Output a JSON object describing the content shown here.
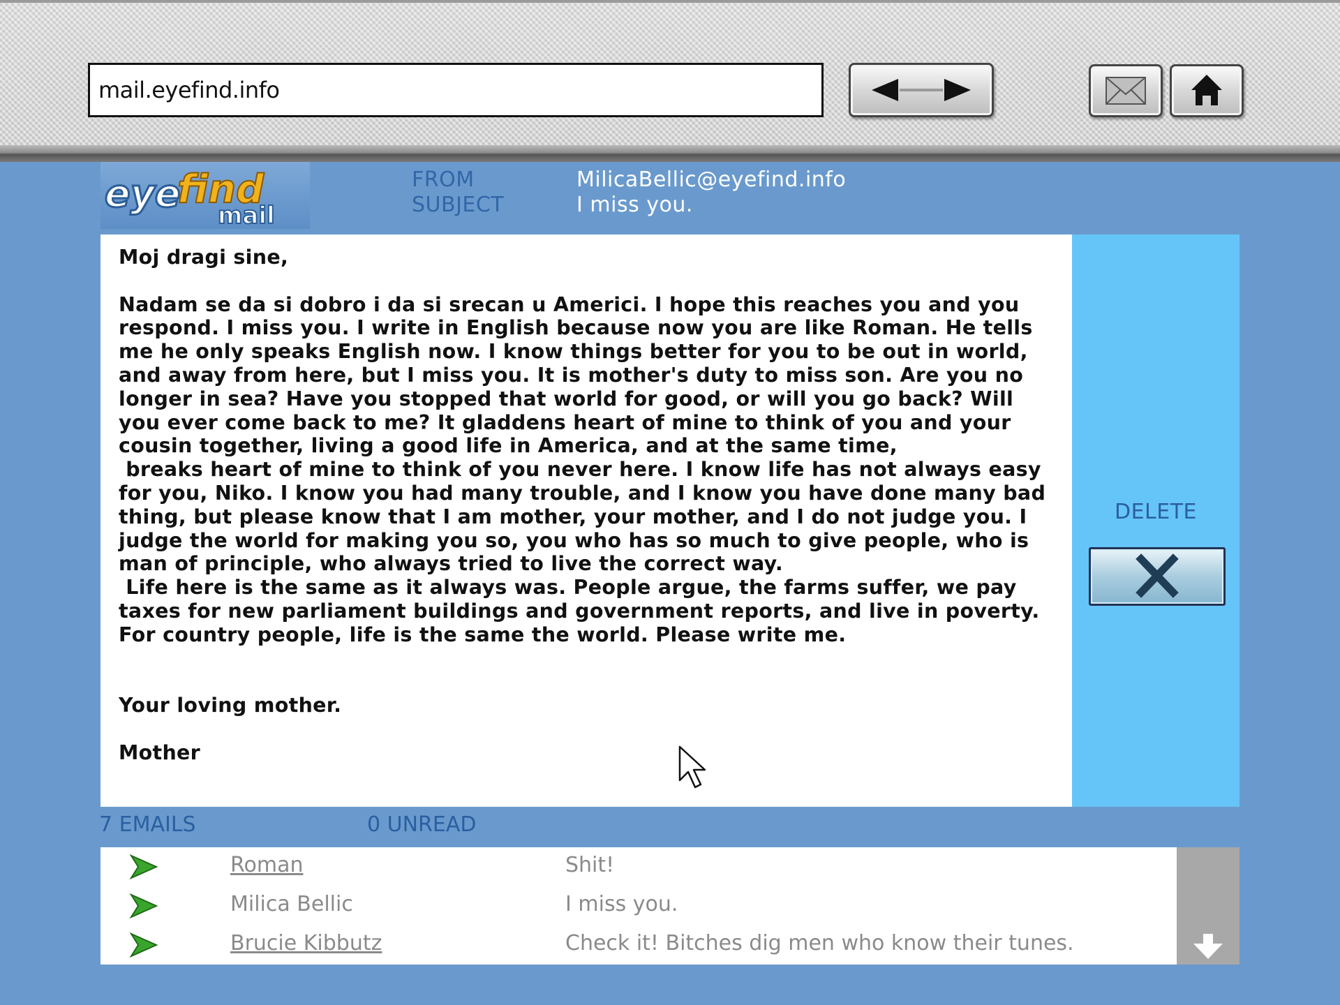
{
  "browser": {
    "url": "mail.eyefind.info"
  },
  "header": {
    "from_label": "FROM",
    "subject_label": "SUBJECT",
    "from_value": "MilicaBellic@eyefind.info",
    "subject_value": "I miss you."
  },
  "message": {
    "paragraphs": [
      "Moj dragi sine,",
      "",
      "Nadam se da si dobro i da si srecan u Americi. I hope this reaches you and you respond. I miss you. I write in English because now you are like Roman. He tells me he only speaks English now. I know things better for you to be out in world, and away from here, but I miss you. It is mother's duty to miss son. Are you no longer in sea? Have you stopped that world for good, or will you go back? Will you ever come back to me? It gladdens heart of mine to think of you and your cousin together, living a good life in America, and at the same time,",
      " breaks heart of mine to think of you never here. I know life has not always easy for you, Niko. I know you had many trouble, and I know you have done many bad thing, but please know that I am mother, your mother, and I do not judge you. I judge the world for making you so, you who has so much to give people, who is man of principle, who always tried to live the correct way.",
      " Life here is the same as it always was. People argue, the farms suffer, we pay taxes for new parliament buildings and government reports, and live in poverty. For country people, life is the same the world. Please write me.",
      "",
      "",
      "Your loving mother.",
      "",
      "Mother"
    ]
  },
  "side": {
    "delete_label": "DELETE"
  },
  "inbox": {
    "email_count": "7 EMAILS",
    "unread_count": "0 UNREAD",
    "rows": [
      {
        "sender": "Roman",
        "subject": "Shit!"
      },
      {
        "sender": "Milica Bellic",
        "subject": "I miss you."
      },
      {
        "sender": "Brucie Kibbutz",
        "subject": "Check it! Bitches dig men who know their tunes."
      }
    ]
  },
  "colors": {
    "background": "#6a9acd",
    "side_panel": "#66c5f8",
    "label_blue": "#2a5fa0",
    "arrow_green": "#3aa52c"
  },
  "icons": {
    "back": "back-arrow-icon",
    "forward": "forward-arrow-icon",
    "mail": "mail-icon",
    "home": "home-icon",
    "delete": "close-x-icon",
    "row_arrow": "play-arrow-icon",
    "scroll_down": "down-arrow-icon",
    "cursor": "mouse-pointer-icon"
  }
}
